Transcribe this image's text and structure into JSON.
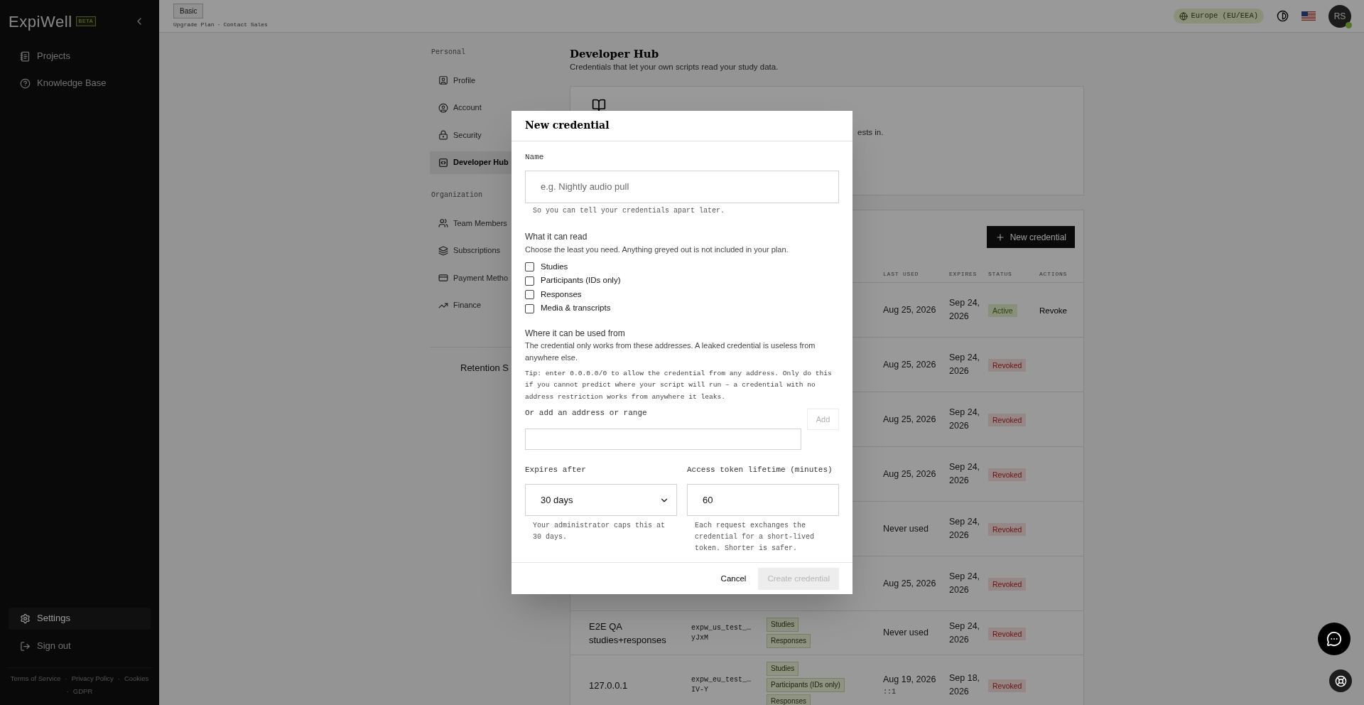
{
  "sidebar": {
    "logo": "ExpiWell",
    "badge": "BETA",
    "nav": [
      {
        "label": "Projects",
        "selected": false
      },
      {
        "label": "Knowledge Base",
        "selected": false
      }
    ],
    "bottom": [
      {
        "label": "Settings",
        "selected": true
      },
      {
        "label": "Sign out",
        "selected": false
      }
    ],
    "footer": {
      "links": [
        "Terms of Service",
        "Privacy Policy",
        "Cookies",
        "GDPR"
      ],
      "separator": "·"
    }
  },
  "topbar": {
    "plan": "Basic",
    "links": [
      "Upgrade Plan",
      "Contact Sales"
    ],
    "separator": "·",
    "region": "Europe (EU/EEA)",
    "avatar": {
      "initials": "RS",
      "online": true
    }
  },
  "settings_nav": {
    "groups": [
      {
        "label": "Personal",
        "items": [
          {
            "label": "Profile",
            "selected": false
          },
          {
            "label": "Account",
            "selected": false
          },
          {
            "label": "Security",
            "selected": false
          },
          {
            "label": "Developer Hub",
            "selected": true
          }
        ]
      },
      {
        "label": "Organization",
        "items": [
          {
            "label": "Team Members",
            "selected": false
          },
          {
            "label": "Subscriptions",
            "selected": false
          },
          {
            "label": "Payment Metho",
            "selected": false
          },
          {
            "label": "Finance",
            "selected": false
          }
        ]
      }
    ],
    "more": "Retention S"
  },
  "page": {
    "title": "Developer Hub",
    "subtitle": "Credentials that let your own scripts read your study data.",
    "intro_fragment": "ests in.",
    "new_button": "New credential",
    "table": {
      "columns": [
        "LAST USED",
        "EXPIRES",
        "STATUS",
        "ACTIONS"
      ],
      "rows": [
        {
          "last_used": "Aug 25, 2026",
          "expires": "Sep 24, 2026",
          "status": {
            "label": "Active",
            "kind": "active"
          },
          "action": "Revoke"
        },
        {
          "last_used": "Aug 25, 2026",
          "expires": "Sep 24, 2026",
          "status": {
            "label": "Revoked",
            "kind": "revoked"
          }
        },
        {
          "last_used": "Aug 25, 2026",
          "expires": "Sep 24, 2026",
          "status": {
            "label": "Revoked",
            "kind": "revoked"
          }
        },
        {
          "last_used": "Aug 25, 2026",
          "expires": "Sep 24, 2026",
          "status": {
            "label": "Revoked",
            "kind": "revoked"
          }
        },
        {
          "last_used": "Never used",
          "expires": "Sep 24, 2026",
          "status": {
            "label": "Revoked",
            "kind": "revoked"
          }
        },
        {
          "last_used": "Aug 25, 2026",
          "expires": "Sep 24, 2026",
          "status": {
            "label": "Revoked",
            "kind": "revoked"
          }
        },
        {
          "name": "E2E QA studies+responses",
          "key": [
            "expw_us_test_…",
            "yJxM"
          ],
          "scopes": [
            "Studies",
            "Responses"
          ],
          "last_used": "Never used",
          "expires": "Sep 24, 2026",
          "status": {
            "label": "Revoked",
            "kind": "revoked"
          }
        },
        {
          "name": "127.0.0.1",
          "key": [
            "expw_eu_test_…",
            "IV-Y"
          ],
          "scopes": [
            "Studies",
            "Participants (IDs only)",
            "Responses"
          ],
          "last_used": "Aug 19, 2026",
          "last_used_detail": "::1",
          "expires": "Sep 18, 2026",
          "status": {
            "label": "Revoked",
            "kind": "revoked"
          }
        }
      ]
    }
  },
  "modal": {
    "title": "New credential",
    "name_field": {
      "label": "Name",
      "placeholder": "e.g. Nightly audio pull",
      "hint": "So you can tell your credentials apart later."
    },
    "scopes": {
      "label": "What it can read",
      "description": "Choose the least you need. Anything greyed out is not included in your plan.",
      "options": [
        {
          "label": "Studies",
          "checked": false
        },
        {
          "label": "Participants (IDs only)",
          "checked": false
        },
        {
          "label": "Responses",
          "checked": false
        },
        {
          "label": "Media & transcripts",
          "checked": false
        }
      ]
    },
    "addresses": {
      "label": "Where it can be used from",
      "description": "The credential only works from these addresses. A leaked credential is useless from anywhere else.",
      "tip": "Tip: enter 0.0.0.0/0 to allow the credential from any address. Only do this if you cannot predict where your script will run – a credential with no address restriction works from anywhere it leaks.",
      "add_label": "Or add an address or range",
      "add_button": {
        "label": "Add",
        "disabled": true
      }
    },
    "expires": {
      "label": "Expires after",
      "value": "30 days",
      "hint": "Your administrator caps this at 30 days."
    },
    "token_lifetime": {
      "label": "Access token lifetime (minutes)",
      "value": "60",
      "hint": "Each request exchanges the credential for a short-lived token. Shorter is safer."
    },
    "cancel": "Cancel",
    "create": {
      "label": "Create credential",
      "disabled": true
    }
  }
}
